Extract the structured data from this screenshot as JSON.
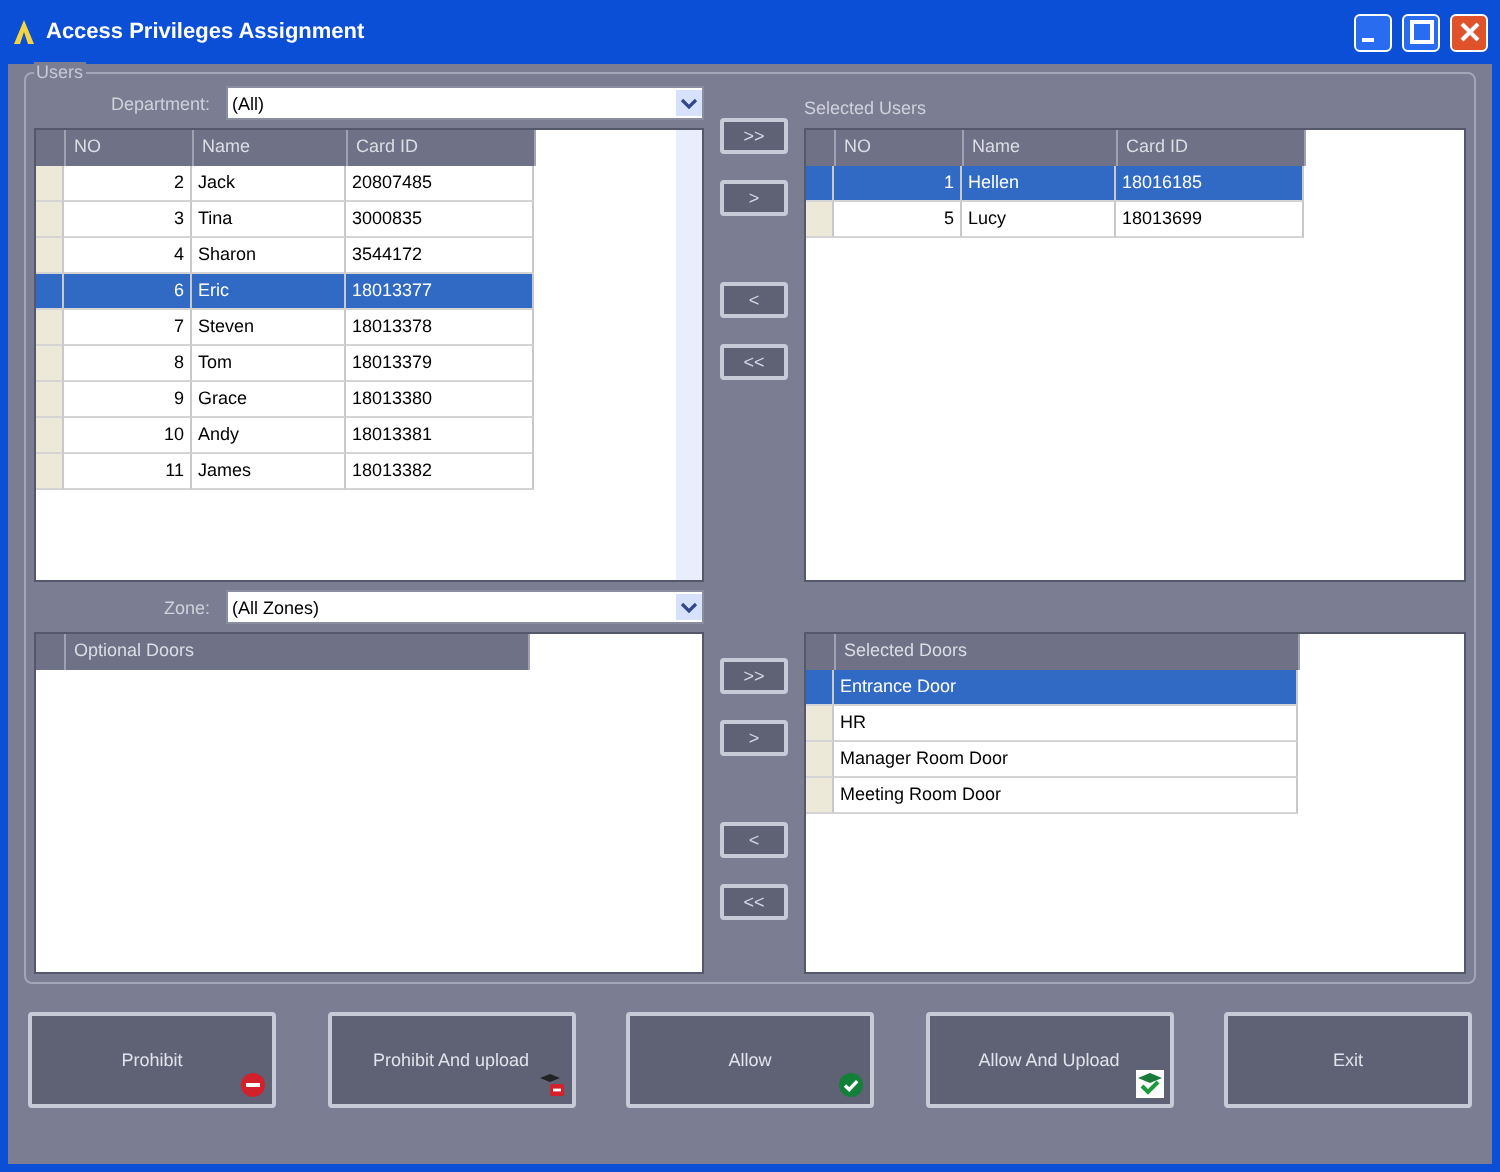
{
  "window": {
    "title": "Access Privileges Assignment"
  },
  "users": {
    "group_label": "Users",
    "department_label": "Department:",
    "department_value": "(All)",
    "columns": [
      "NO",
      "Name",
      "Card ID"
    ],
    "rows": [
      {
        "no": "2",
        "name": "Jack",
        "card_id": "20807485",
        "selected": false
      },
      {
        "no": "3",
        "name": "Tina",
        "card_id": "3000835",
        "selected": false
      },
      {
        "no": "4",
        "name": "Sharon",
        "card_id": "3544172",
        "selected": false
      },
      {
        "no": "6",
        "name": "Eric",
        "card_id": "18013377",
        "selected": true
      },
      {
        "no": "7",
        "name": "Steven",
        "card_id": "18013378",
        "selected": false
      },
      {
        "no": "8",
        "name": "Tom",
        "card_id": "18013379",
        "selected": false
      },
      {
        "no": "9",
        "name": "Grace",
        "card_id": "18013380",
        "selected": false
      },
      {
        "no": "10",
        "name": "Andy",
        "card_id": "18013381",
        "selected": false
      },
      {
        "no": "11",
        "name": "James",
        "card_id": "18013382",
        "selected": false
      }
    ],
    "move_buttons": [
      ">>",
      ">",
      "<",
      "<<"
    ],
    "selected_label": "Selected Users",
    "selected_columns": [
      "NO",
      "Name",
      "Card ID"
    ],
    "selected_rows": [
      {
        "no": "1",
        "name": "Hellen",
        "card_id": "18016185",
        "selected": true
      },
      {
        "no": "5",
        "name": "Lucy",
        "card_id": "18013699",
        "selected": false
      }
    ]
  },
  "doors": {
    "zone_label": "Zone:",
    "zone_value": "(All Zones)",
    "optional_header": "Optional Doors",
    "move_buttons": [
      ">>",
      ">",
      "<",
      "<<"
    ],
    "selected_header": "Selected Doors",
    "selected_rows": [
      {
        "name": "Entrance Door",
        "selected": true
      },
      {
        "name": "HR",
        "selected": false
      },
      {
        "name": "Manager Room Door",
        "selected": false
      },
      {
        "name": "Meeting Room Door",
        "selected": false
      }
    ]
  },
  "actions": [
    {
      "label": "Prohibit",
      "kind": "prohibit"
    },
    {
      "label": "Prohibit And upload",
      "kind": "prohibit_upload"
    },
    {
      "label": "Allow",
      "kind": "allow"
    },
    {
      "label": "Allow And Upload",
      "kind": "allow_upload"
    },
    {
      "label": "Exit",
      "kind": "plain"
    }
  ]
}
